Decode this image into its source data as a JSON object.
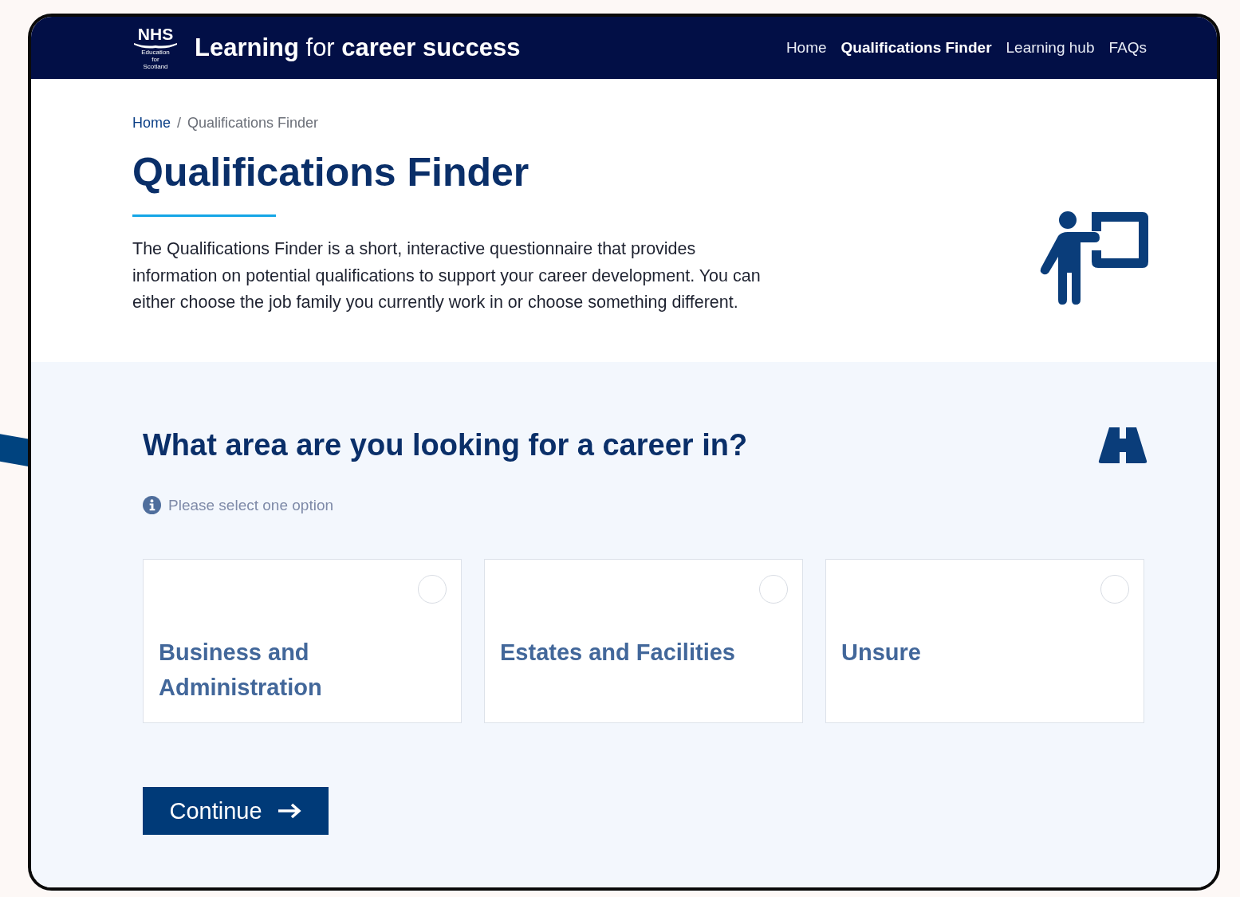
{
  "header": {
    "logo": {
      "name": "NHS",
      "lines": [
        "Education",
        "for",
        "Scotland"
      ]
    },
    "site_title": "**Learning** for **career success**",
    "nav": [
      {
        "label": "Home",
        "selected": false
      },
      {
        "label": "Qualifications Finder",
        "selected": true
      },
      {
        "label": "Learning hub",
        "selected": false
      },
      {
        "label": "FAQs",
        "selected": false
      }
    ]
  },
  "breadcrumb": [
    {
      "label": "Home",
      "kind": "link"
    },
    {
      "label": "/",
      "kind": "separator"
    },
    {
      "label": "Qualifications Finder",
      "kind": "current"
    }
  ],
  "page_title": "Qualifications Finder",
  "intro": "The Qualifications Finder is a short, interactive questionnaire that provides information on potential qualifications to support your career development. You can either choose the job family you currently work in or choose something different.",
  "question": {
    "title": "What area are you looking for a career in?",
    "hint": "Please select one option",
    "options": [
      {
        "label": "Business and Administration",
        "selected": false
      },
      {
        "label": "Estates and Facilities",
        "selected": false
      },
      {
        "label": "Unsure",
        "selected": false
      }
    ]
  },
  "continue_button": "Continue"
}
